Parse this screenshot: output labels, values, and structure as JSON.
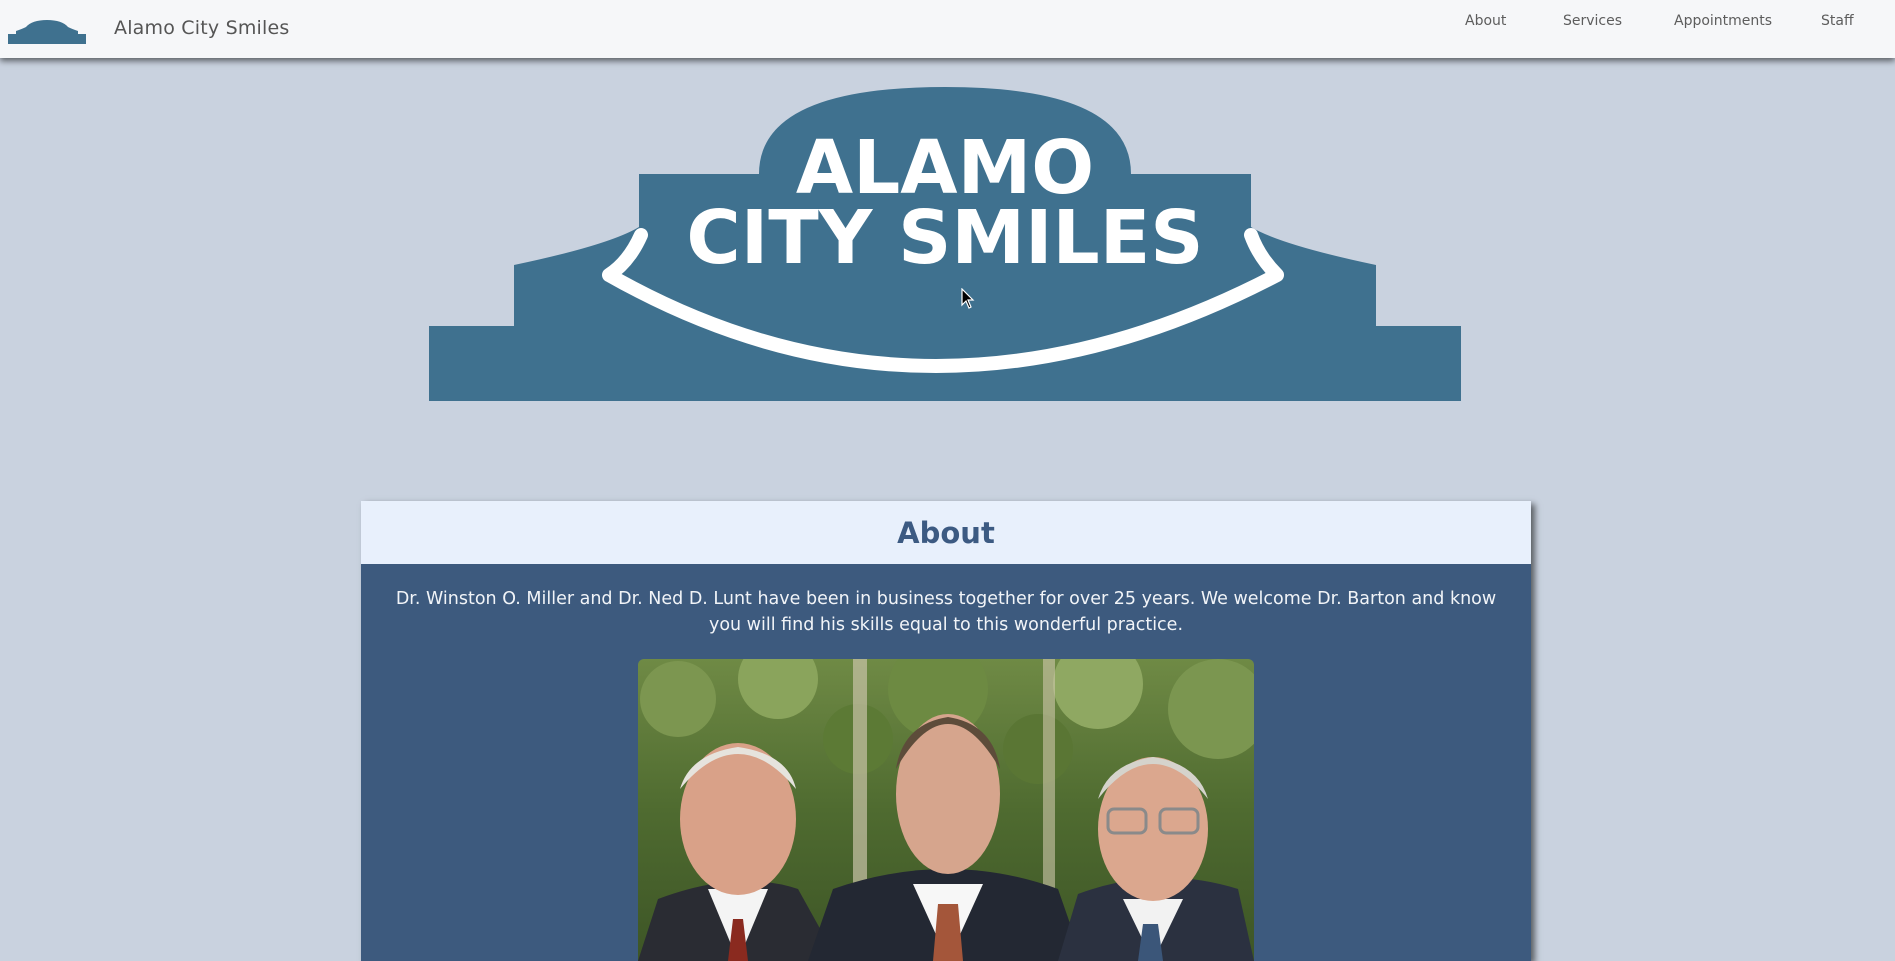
{
  "navbar": {
    "brand": "Alamo City Smiles",
    "links": [
      {
        "label": "About"
      },
      {
        "label": "Services"
      },
      {
        "label": "Appointments"
      },
      {
        "label": "Staff"
      }
    ]
  },
  "hero": {
    "logo_line1": "ALAMO",
    "logo_line2": "CITY SMILES"
  },
  "about": {
    "title": "About",
    "body": "Dr. Winston O. Miller and Dr. Ned D. Lunt have been in business together for over 25 years. We welcome Dr. Barton and know you will find his skills equal to this wonderful practice."
  },
  "colors": {
    "page_background": "#c9d2df",
    "navbar_background": "#f6f7f9",
    "logo_blue": "#3f718f",
    "card_background": "#3d5a7e",
    "card_header_background": "#e8f0fc",
    "card_title": "#3c5a82"
  },
  "icons": {
    "nav_logo": "alamo-facade-icon",
    "cursor": "mouse-pointer-icon"
  }
}
